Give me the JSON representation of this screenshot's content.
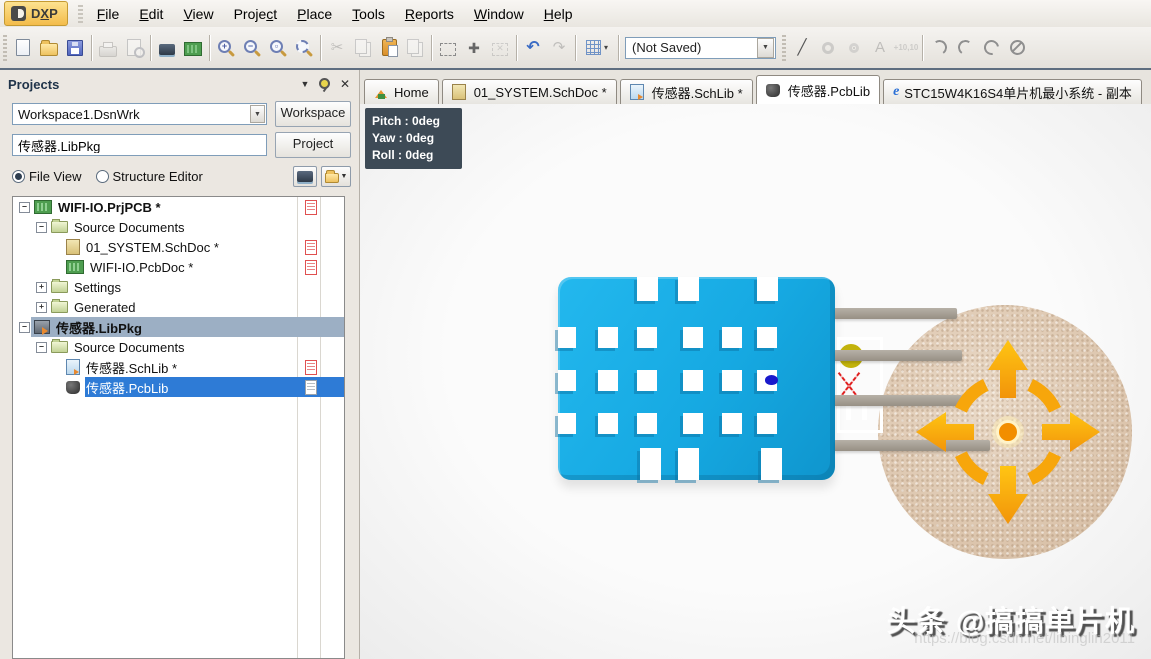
{
  "app": {
    "logo_button": "DXP"
  },
  "menu": {
    "items": [
      {
        "label": "File",
        "u": 0
      },
      {
        "label": "Edit",
        "u": 0
      },
      {
        "label": "View",
        "u": 0
      },
      {
        "label": "Project",
        "u": 5
      },
      {
        "label": "Place",
        "u": 0
      },
      {
        "label": "Tools",
        "u": 0
      },
      {
        "label": "Reports",
        "u": 0
      },
      {
        "label": "Window",
        "u": 0
      },
      {
        "label": "Help",
        "u": 0
      }
    ]
  },
  "toolbar": {
    "groups": [
      {
        "items": [
          {
            "name": "new-document",
            "icon": "page",
            "enabled": true
          },
          {
            "name": "open-document",
            "icon": "folder-open",
            "enabled": true
          },
          {
            "name": "save-document",
            "icon": "floppy",
            "enabled": true
          }
        ]
      },
      {
        "items": [
          {
            "name": "print",
            "icon": "printer",
            "enabled": false
          },
          {
            "name": "print-preview",
            "icon": "page-magnifier",
            "enabled": false
          }
        ]
      },
      {
        "items": [
          {
            "name": "view-3d",
            "icon": "chip",
            "enabled": true
          },
          {
            "name": "browse-board",
            "icon": "board",
            "enabled": true
          }
        ]
      },
      {
        "items": [
          {
            "name": "zoom-in",
            "icon": "mag-plus",
            "enabled": true
          },
          {
            "name": "zoom-out",
            "icon": "mag-minus",
            "enabled": true
          },
          {
            "name": "zoom-document",
            "icon": "mag-doc",
            "enabled": true
          },
          {
            "name": "zoom-area",
            "icon": "mag-area",
            "enabled": true
          }
        ]
      },
      {
        "items": [
          {
            "name": "cut",
            "icon": "scissors",
            "enabled": false
          },
          {
            "name": "copy",
            "icon": "copy",
            "enabled": false
          },
          {
            "name": "paste",
            "icon": "clipboard",
            "enabled": true
          },
          {
            "name": "paste-array",
            "icon": "copy",
            "enabled": false
          }
        ]
      },
      {
        "items": [
          {
            "name": "select-region",
            "icon": "dashed-rect",
            "enabled": true
          },
          {
            "name": "move-object",
            "icon": "move-cross",
            "enabled": true
          },
          {
            "name": "clear-selection",
            "icon": "deselect",
            "enabled": false
          }
        ]
      },
      {
        "items": [
          {
            "name": "undo",
            "icon": "undo",
            "enabled": true
          },
          {
            "name": "redo",
            "icon": "redo",
            "enabled": false
          }
        ]
      }
    ],
    "grid_button": {
      "name": "snap-grid",
      "icon": "grid"
    },
    "layer_combo": {
      "value": "(Not Saved)"
    },
    "draw_tools": [
      {
        "name": "place-line",
        "icon": "line",
        "enabled": true
      },
      {
        "name": "place-pad",
        "icon": "pad",
        "enabled": false
      },
      {
        "name": "place-via",
        "icon": "via",
        "enabled": false
      },
      {
        "name": "place-string",
        "icon": "string",
        "enabled": false
      },
      {
        "name": "place-coordinate",
        "icon": "coordinate",
        "enabled": false
      }
    ],
    "arc_tools": [
      {
        "name": "place-arc-edge",
        "icon": "arc-a1",
        "enabled": true
      },
      {
        "name": "place-arc-center",
        "icon": "arc-a2",
        "enabled": true
      },
      {
        "name": "place-arc-any-angle",
        "icon": "arc-a3",
        "enabled": true
      },
      {
        "name": "place-full-circle",
        "icon": "arc-a4",
        "enabled": true
      }
    ]
  },
  "tabs": [
    {
      "label": "Home",
      "icon": "home",
      "active": false
    },
    {
      "label": "01_SYSTEM.SchDoc *",
      "icon": "schdoc",
      "active": false
    },
    {
      "label": "传感器.SchLib *",
      "icon": "schlib",
      "active": false
    },
    {
      "label": "传感器.PcbLib",
      "icon": "pcblib",
      "active": true
    },
    {
      "label": "STC15W4K16S4单片机最小系统 - 副本",
      "icon": "browser",
      "active": false
    }
  ],
  "projects_panel": {
    "title": "Projects",
    "workspace": {
      "value": "Workspace1.DsnWrk",
      "button": "Workspace"
    },
    "project": {
      "value": "传感器.LibPkg",
      "button": "Project"
    },
    "view_radios": [
      {
        "label": "File View",
        "selected": true
      },
      {
        "label": "Structure Editor",
        "selected": false
      }
    ],
    "tree": [
      {
        "label": "WIFI-IO.PrjPCB *",
        "level": 0,
        "icon": "prjpcb",
        "expander": "minus",
        "bold": true,
        "status": "red"
      },
      {
        "label": "Source Documents",
        "level": 1,
        "icon": "folder",
        "expander": "minus"
      },
      {
        "label": "01_SYSTEM.SchDoc *",
        "level": 2,
        "icon": "schdoc",
        "status": "red"
      },
      {
        "label": "WIFI-IO.PcbDoc *",
        "level": 2,
        "icon": "pcbdoc",
        "status": "red"
      },
      {
        "label": "Settings",
        "level": 1,
        "icon": "folder",
        "expander": "plus"
      },
      {
        "label": "Generated",
        "level": 1,
        "icon": "folder",
        "expander": "plus"
      },
      {
        "label": "传感器.LibPkg",
        "level": 0,
        "icon": "libpkg",
        "expander": "minus",
        "bold": true,
        "highlight": "gray"
      },
      {
        "label": "Source Documents",
        "level": 1,
        "icon": "folder",
        "expander": "minus"
      },
      {
        "label": "传感器.SchLib *",
        "level": 2,
        "icon": "schlib",
        "status": "red"
      },
      {
        "label": "传感器.PcbLib",
        "level": 2,
        "icon": "pcblib",
        "status": "white",
        "highlight": "blue"
      }
    ]
  },
  "viewport": {
    "orientation": {
      "pitch_label": "Pitch : 0deg",
      "yaw_label": "Yaw : 0deg",
      "roll_label": "Roll : 0deg"
    },
    "watermark": {
      "line1": "头条 @搞搞单片机",
      "line2": "https://blog.csdn.net/libinglin2011"
    },
    "colors": {
      "sensor_body": "#16A9E2",
      "sensor_bevel": "#0A6E9E",
      "pin": "#A49E95",
      "sphere": "#DCC5AD",
      "arrow_orange": "#F7A60B",
      "overlay_bg": "#3D4A56",
      "selection_blue": "#2E7BD6",
      "selection_gray": "#9CAFC4"
    }
  }
}
